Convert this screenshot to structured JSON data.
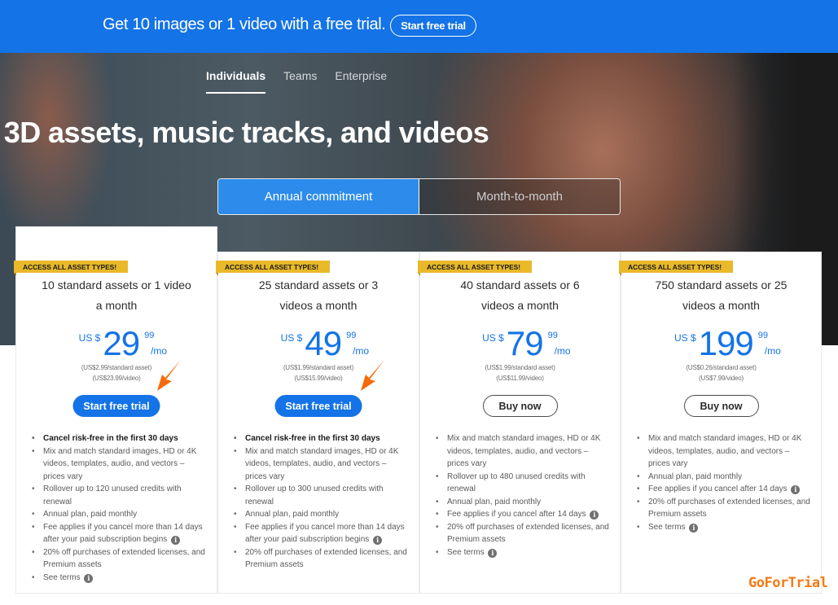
{
  "promo": {
    "text": "Get 10 images or 1 video with a free trial.",
    "button_label": "Start free trial"
  },
  "segments": {
    "tabs": [
      {
        "label": "Individuals",
        "active": true
      },
      {
        "label": "Teams",
        "active": false
      },
      {
        "label": "Enterprise",
        "active": false
      }
    ]
  },
  "hero": {
    "title": ", 3D assets, music tracks, and videos"
  },
  "billing_toggle": {
    "options": [
      {
        "label": "Annual commitment",
        "active": true
      },
      {
        "label": "Month-to-month",
        "active": false
      }
    ]
  },
  "plans": [
    {
      "badge": "ACCESS ALL ASSET TYPES!",
      "title": "10 standard assets or 1 video a month",
      "currency": "US $",
      "price_main": "29",
      "price_cents": "99",
      "period": "/mo",
      "per_asset": "(US$2.99/standard asset)",
      "per_video": "(US$23.99/video)",
      "cta_label": "Start free trial",
      "cta_style": "primary",
      "features": [
        {
          "text": "Cancel risk-free in the first 30 days",
          "bold": true
        },
        {
          "text": "Mix and match standard images, HD or 4K videos, templates, audio, and vectors – prices vary"
        },
        {
          "text": "Rollover up to 120 unused credits with renewal"
        },
        {
          "text": "Annual plan, paid monthly"
        },
        {
          "text": "Fee applies if you cancel more than 14 days after your paid subscription begins",
          "info": true
        },
        {
          "text": "20% off purchases of extended licenses, and Premium assets"
        },
        {
          "text": "See terms",
          "info": true
        }
      ]
    },
    {
      "badge": "ACCESS ALL ASSET TYPES!",
      "title": "25 standard assets or 3 videos a month",
      "currency": "US $",
      "price_main": "49",
      "price_cents": "99",
      "period": "/mo",
      "per_asset": "(US$1.99/standard asset)",
      "per_video": "(US$15.99/video)",
      "cta_label": "Start free trial",
      "cta_style": "primary",
      "features": [
        {
          "text": "Cancel risk-free in the first 30 days",
          "bold": true
        },
        {
          "text": "Mix and match standard images, HD or 4K videos, templates, audio, and vectors – prices vary"
        },
        {
          "text": "Rollover up to 300 unused credits with renewal"
        },
        {
          "text": "Annual plan, paid monthly"
        },
        {
          "text": "Fee applies if you cancel more than 14 days after your paid subscription begins",
          "info": true
        },
        {
          "text": "20% off purchases of extended licenses, and Premium assets"
        }
      ]
    },
    {
      "badge": "ACCESS ALL ASSET TYPES!",
      "title": "40 standard assets or 6 videos a month",
      "currency": "US $",
      "price_main": "79",
      "price_cents": "99",
      "period": "/mo",
      "per_asset": "(US$1.99/standard asset)",
      "per_video": "(US$11.99/video)",
      "cta_label": "Buy now",
      "cta_style": "outline",
      "features": [
        {
          "text": "Mix and match standard images, HD or 4K videos, templates, audio, and vectors – prices vary"
        },
        {
          "text": "Rollover up to 480 unused credits with renewal"
        },
        {
          "text": "Annual plan, paid monthly"
        },
        {
          "text": "Fee applies if you cancel after 14 days",
          "info": true
        },
        {
          "text": "20% off purchases of extended licenses, and Premium assets"
        },
        {
          "text": "See terms",
          "info": true
        }
      ]
    },
    {
      "badge": "ACCESS ALL ASSET TYPES!",
      "title": "750 standard assets or 25 videos a month",
      "currency": "US $",
      "price_main": "199",
      "price_cents": "99",
      "period": "/mo",
      "per_asset": "(US$0.26/standard asset)",
      "per_video": "(US$7.99/video)",
      "cta_label": "Buy now",
      "cta_style": "outline",
      "features": [
        {
          "text": "Mix and match standard images, HD or 4K videos, templates, audio, and vectors – prices vary"
        },
        {
          "text": "Annual plan, paid monthly"
        },
        {
          "text": "Fee applies if you cancel after 14 days",
          "info": true
        },
        {
          "text": "20% off purchases of extended licenses, and Premium assets"
        },
        {
          "text": "See terms",
          "info": true
        }
      ]
    }
  ],
  "watermark": "GoForTrial",
  "colors": {
    "brand_blue": "#1473e6",
    "toggle_active": "#2d8ceb",
    "badge_yellow": "#e9b92a",
    "arrow_orange": "#f56a0a",
    "watermark_orange": "#f57a14"
  }
}
